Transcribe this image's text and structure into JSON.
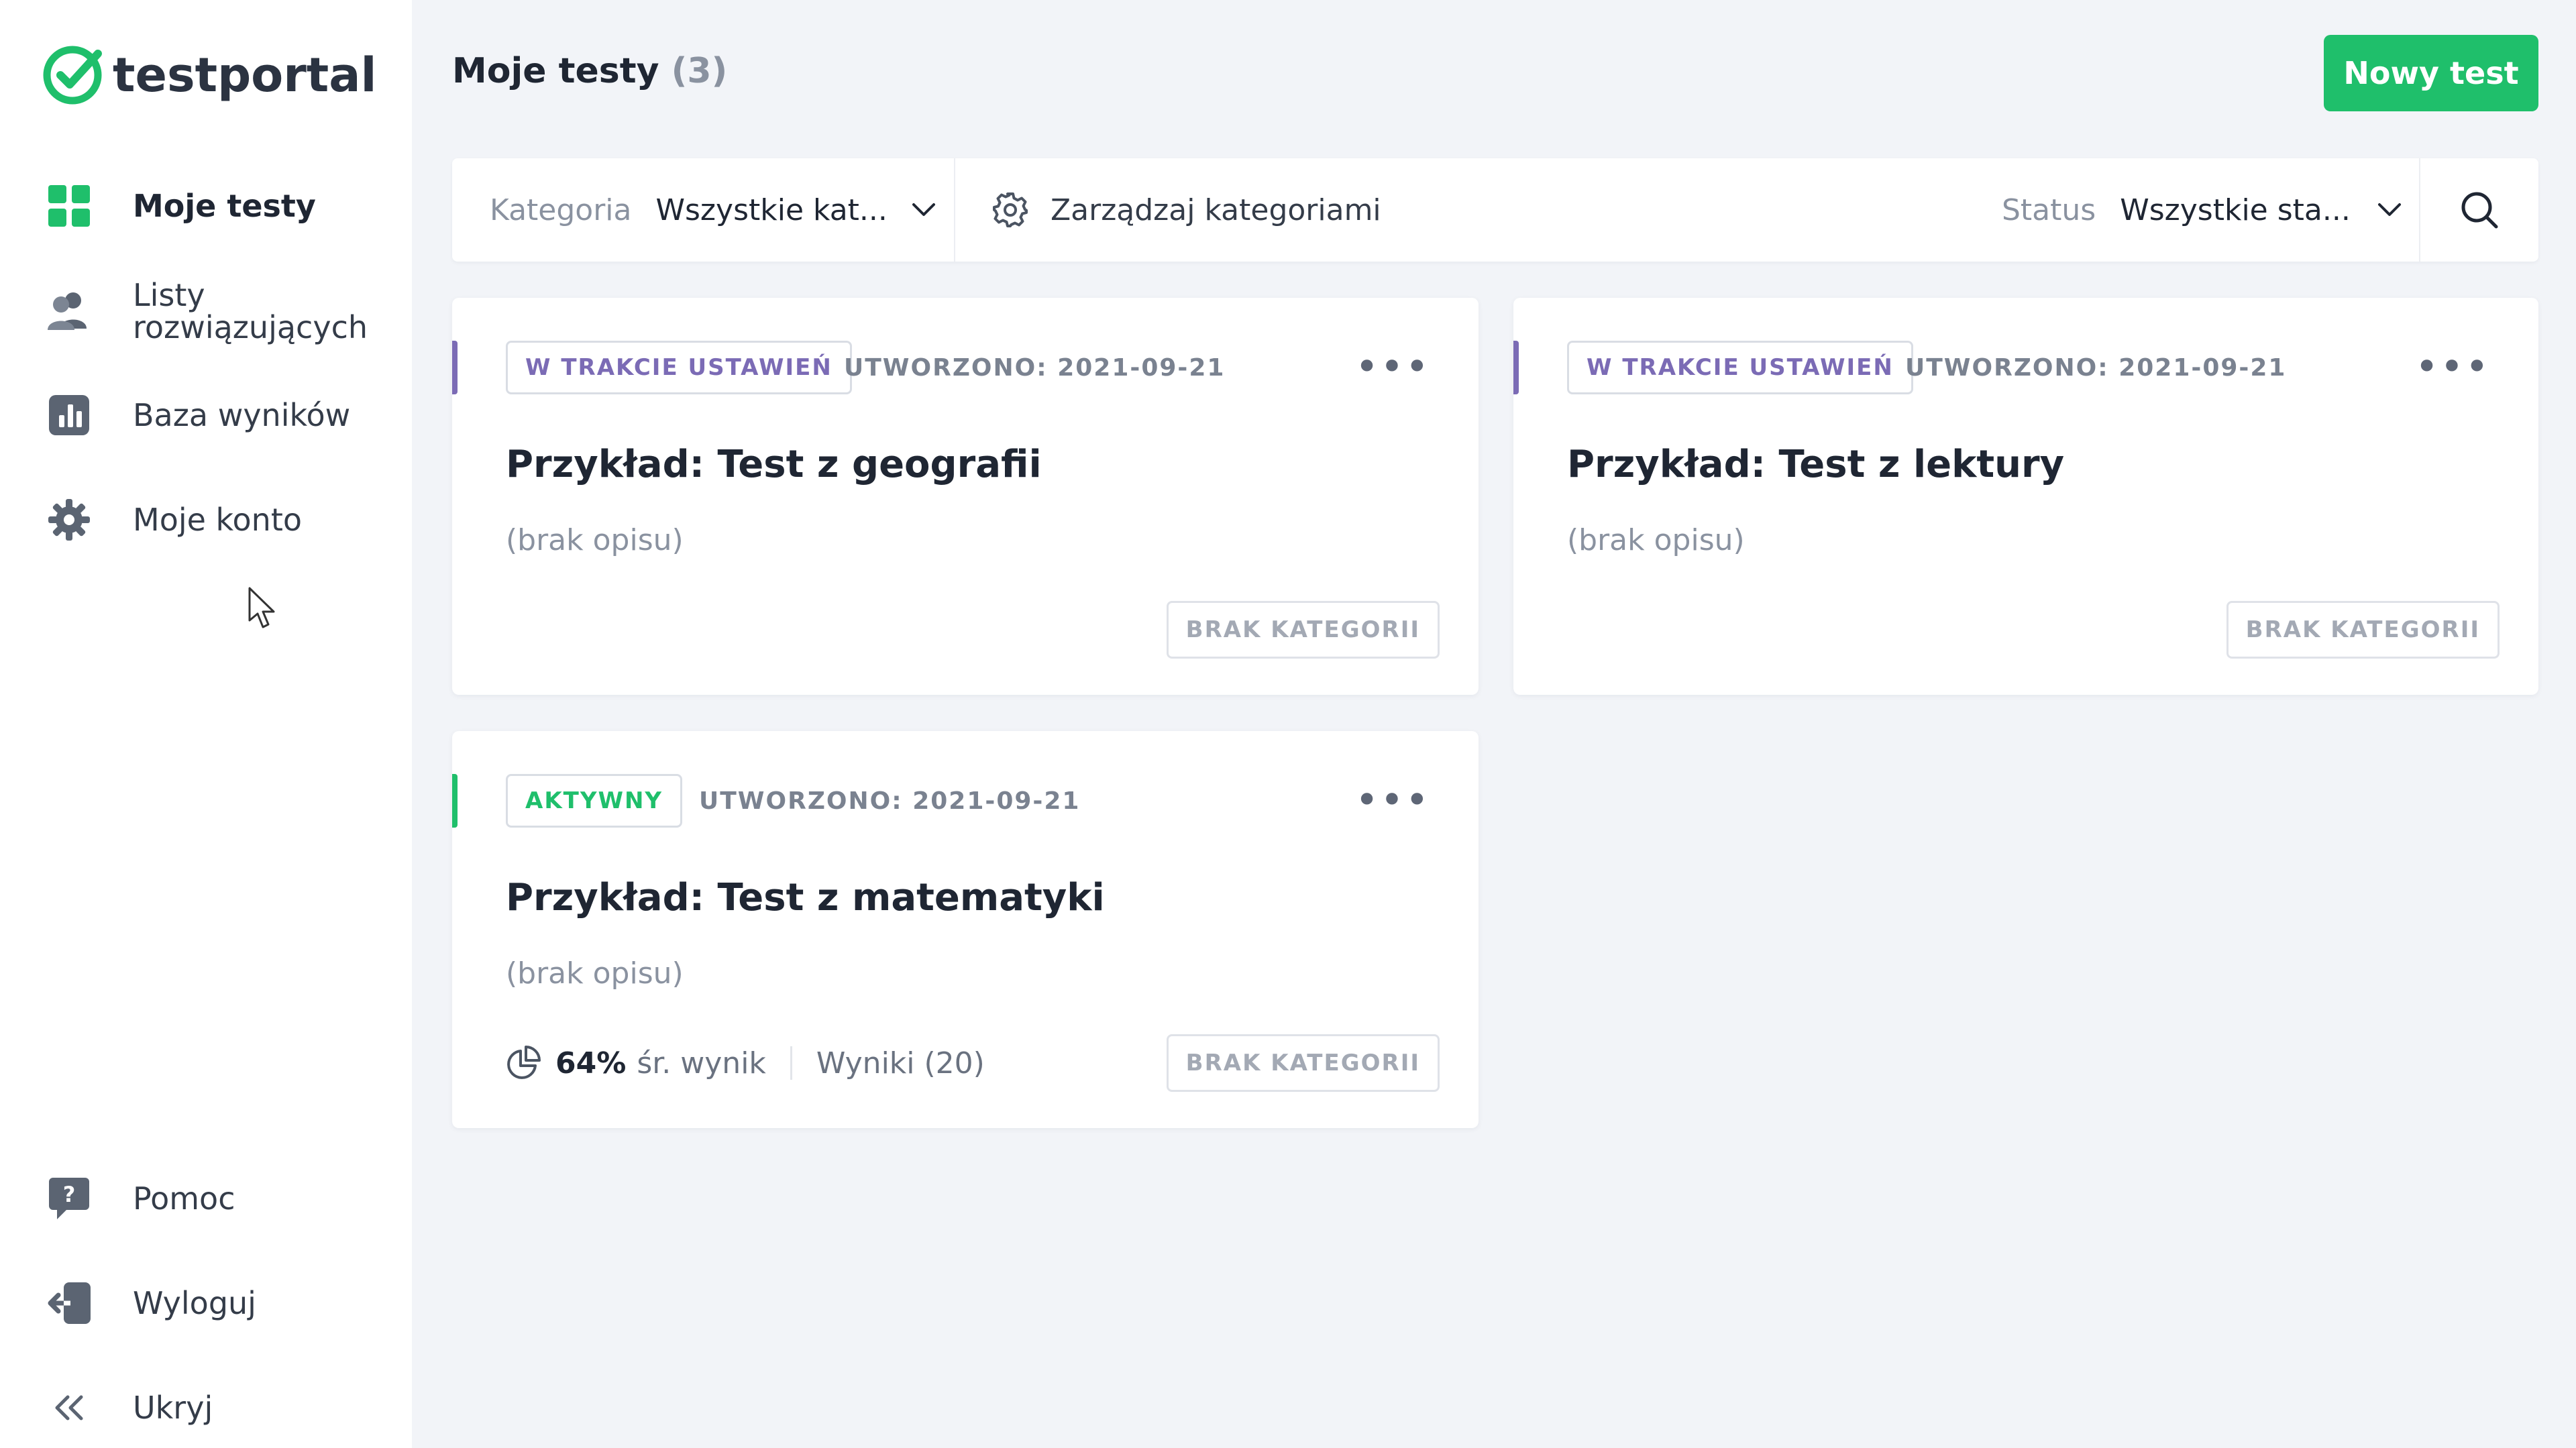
{
  "app": {
    "name": "testportal",
    "brand_color": "#1fbf6b"
  },
  "sidebar": {
    "items": [
      {
        "label": "Moje testy",
        "icon": "grid-icon"
      },
      {
        "label_line1": "Listy",
        "label_line2": "rozwiązujących",
        "icon": "users-icon"
      },
      {
        "label": "Baza wyników",
        "icon": "chart-icon"
      },
      {
        "label": "Moje konto",
        "icon": "gear-icon"
      }
    ],
    "bottom": [
      {
        "label": "Pomoc",
        "icon": "help-icon"
      },
      {
        "label": "Wyloguj",
        "icon": "logout-icon"
      },
      {
        "label": "Ukryj",
        "icon": "collapse-icon"
      }
    ]
  },
  "header": {
    "title": "Moje testy",
    "count": "(3)",
    "new_button": "Nowy test"
  },
  "filters": {
    "category_label": "Kategoria",
    "category_value": "Wszystkie kat...",
    "manage_label": "Zarządzaj kategoriami",
    "status_label": "Status",
    "status_value": "Wszystkie sta..."
  },
  "cards": [
    {
      "status": "W TRAKCIE USTAWIEŃ",
      "status_color": "#7b6bb5",
      "created": "UTWORZONO: 2021-09-21",
      "title": "Przykład: Test z geografii",
      "desc": "(brak opisu)",
      "category": "BRAK KATEGORII"
    },
    {
      "status": "W TRAKCIE USTAWIEŃ",
      "status_color": "#7b6bb5",
      "created": "UTWORZONO: 2021-09-21",
      "title": "Przykład: Test z lektury",
      "desc": "(brak opisu)",
      "category": "BRAK KATEGORII"
    },
    {
      "status": "AKTYWNY",
      "status_color": "#1fbf6b",
      "created": "UTWORZONO: 2021-09-21",
      "title": "Przykład: Test z matematyki",
      "desc": "(brak opisu)",
      "category": "BRAK KATEGORII",
      "avg_score": "64%",
      "avg_label": "śr. wynik",
      "results": "Wyniki (20)"
    }
  ]
}
